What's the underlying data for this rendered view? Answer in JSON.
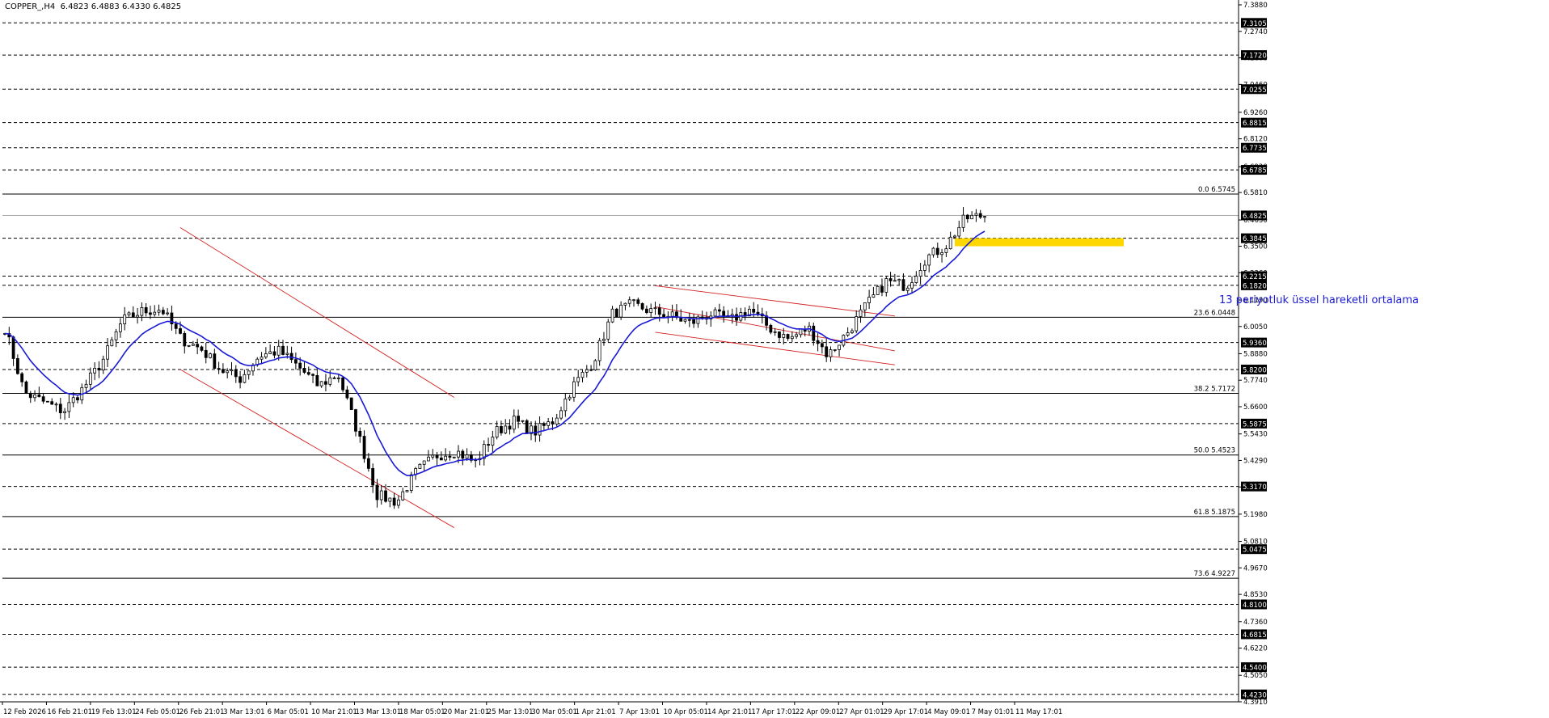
{
  "header": {
    "symbol": "COPPER_,H4",
    "ohlc": "6.4823 6.4883 6.4330 6.4825"
  },
  "annotation": {
    "ema_note": "13 periyotluk üssel hareketli ortalama"
  },
  "colors": {
    "candle": "#000000",
    "ema": "#1a1ad6",
    "channel": "#d42020",
    "zone": "#ffd700",
    "grid": "#000000"
  },
  "chart_data": {
    "type": "candlestick",
    "symbol": "COPPER_",
    "timeframe": "H4",
    "ylim": [
      4.391,
      7.388
    ],
    "y_ticks": [
      "7.3880",
      "7.2740",
      "7.1600",
      "7.0460",
      "6.9260",
      "6.8120",
      "6.6920",
      "6.5810",
      "6.4630",
      "6.3500",
      "6.2360",
      "6.1190",
      "6.0050",
      "5.8880",
      "5.7740",
      "5.6600",
      "5.5430",
      "5.4290",
      "5.3150",
      "5.1980",
      "5.0810",
      "4.9670",
      "4.8530",
      "4.7360",
      "4.6220",
      "4.5050",
      "4.3910"
    ],
    "x_labels": [
      "12 Feb 2026",
      "16 Feb 21:01",
      "19 Feb 13:01",
      "24 Feb 05:01",
      "26 Feb 21:01",
      "3 Mar 13:01",
      "6 Mar 05:01",
      "10 Mar 21:01",
      "13 Mar 13:01",
      "18 Mar 05:01",
      "20 Mar 21:01",
      "25 Mar 13:01",
      "30 Mar 05:01",
      "1 Apr 21:01",
      "7 Apr 13:01",
      "10 Apr 05:01",
      "14 Apr 21:01",
      "17 Apr 17:01",
      "22 Apr 09:01",
      "27 Apr 01:01",
      "29 Apr 17:01",
      "4 May 09:01",
      "7 May 01:01",
      "11 May 17:01"
    ],
    "dashed_levels": [
      "7.3105",
      "7.1720",
      "7.0255",
      "6.8815",
      "6.7735",
      "6.6785",
      "6.3845",
      "6.2215",
      "6.1820",
      "5.9360",
      "5.8200",
      "5.5875",
      "5.3170",
      "5.0475",
      "4.8100",
      "4.6815",
      "4.5400",
      "4.4230"
    ],
    "fibonacci": [
      {
        "label": "0.0 6.5745",
        "value": 6.5745
      },
      {
        "label": "23.6 6.0448",
        "value": 6.0448
      },
      {
        "label": "38.2 5.7172",
        "value": 5.7172
      },
      {
        "label": "50.0 5.4523",
        "value": 5.4523
      },
      {
        "label": "61.8 5.1875",
        "value": 5.1875
      },
      {
        "label": "73.6 4.9227",
        "value": 4.9227
      }
    ],
    "last_price": {
      "label": "6.4825",
      "value": 6.4825
    },
    "resistance_zone": {
      "from": 6.3845,
      "to": 6.35
    },
    "price_path": [
      [
        "12 Feb 2026",
        6.0
      ],
      [
        "14 Feb",
        5.72
      ],
      [
        "16 Feb 21:01",
        5.68
      ],
      [
        "18 Feb",
        5.64
      ],
      [
        "19 Feb 13:01",
        5.74
      ],
      [
        "22 Feb",
        5.86
      ],
      [
        "24 Feb 05:01",
        6.03
      ],
      [
        "25 Feb",
        6.07
      ],
      [
        "26 Feb 21:01",
        6.08
      ],
      [
        "1 Mar",
        5.95
      ],
      [
        "3 Mar 13:01",
        5.91
      ],
      [
        "5 Mar",
        5.82
      ],
      [
        "6 Mar 05:01",
        5.78
      ],
      [
        "8 Mar",
        5.88
      ],
      [
        "10 Mar 21:01",
        5.9
      ],
      [
        "12 Mar",
        5.83
      ],
      [
        "13 Mar 13:01",
        5.75
      ],
      [
        "16 Mar",
        5.8
      ],
      [
        "18 Mar 05:01",
        5.55
      ],
      [
        "19 Mar",
        5.28
      ],
      [
        "20 Mar 21:01",
        5.25
      ],
      [
        "23 Mar",
        5.38
      ],
      [
        "25 Mar 13:01",
        5.45
      ],
      [
        "28 Mar",
        5.47
      ],
      [
        "30 Mar 05:01",
        5.42
      ],
      [
        "31 Mar",
        5.55
      ],
      [
        "1 Apr 21:01",
        5.6
      ],
      [
        "3 Apr",
        5.55
      ],
      [
        "7 Apr 13:01",
        5.6
      ],
      [
        "8 Apr",
        5.75
      ],
      [
        "10 Apr 05:01",
        5.85
      ],
      [
        "12 Apr",
        6.06
      ],
      [
        "14 Apr 21:01",
        6.1
      ],
      [
        "16 Apr",
        6.07
      ],
      [
        "17 Apr 17:01",
        6.05
      ],
      [
        "20 Apr",
        6.02
      ],
      [
        "22 Apr 09:01",
        6.06
      ],
      [
        "24 Apr",
        6.03
      ],
      [
        "27 Apr 01:01",
        6.08
      ],
      [
        "28 Apr",
        6.0
      ],
      [
        "29 Apr 17:01",
        5.95
      ],
      [
        "1 May",
        6.0
      ],
      [
        "4 May 09:01",
        5.88
      ],
      [
        "5 May",
        5.98
      ],
      [
        "6 May",
        6.1
      ],
      [
        "7 May 01:01",
        6.2
      ],
      [
        "8 May",
        6.18
      ],
      [
        "9 May",
        6.3
      ],
      [
        "10 May",
        6.35
      ],
      [
        "11 May",
        6.47
      ],
      [
        "11 May 17:01",
        6.4825
      ]
    ],
    "ema_period": 13
  }
}
